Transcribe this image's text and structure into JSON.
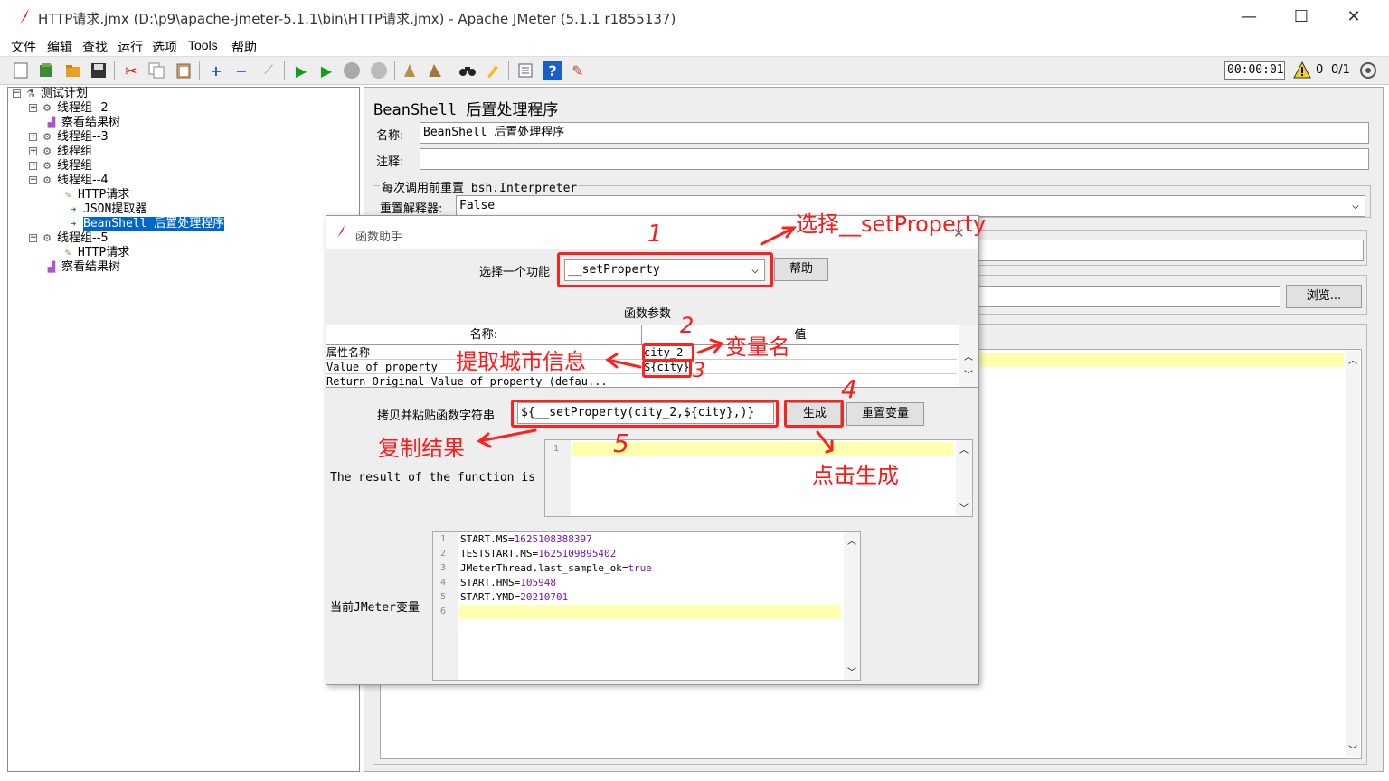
{
  "window": {
    "title": "HTTP请求.jmx (D:\\p9\\apache-jmeter-5.1.1\\bin\\HTTP请求.jmx) - Apache JMeter (5.1.1 r1855137)",
    "minimize": "—",
    "maximize": "☐",
    "close": "✕"
  },
  "menu": [
    "文件",
    "编辑",
    "查找",
    "运行",
    "选项",
    "Tools",
    "帮助"
  ],
  "toolbar": {
    "timer": "00:00:01",
    "warnings": "0",
    "threads": "0/1"
  },
  "tree": [
    {
      "label": "测试计划",
      "icon": "flask-icon"
    },
    {
      "label": "线程组--2",
      "icon": "gear-icon"
    },
    {
      "label": "察看结果树",
      "icon": "chart-icon"
    },
    {
      "label": "线程组--3",
      "icon": "gear-icon"
    },
    {
      "label": "线程组",
      "icon": "gear-icon"
    },
    {
      "label": "线程组",
      "icon": "gear-icon"
    },
    {
      "label": "线程组--4",
      "icon": "gear-icon"
    },
    {
      "label": "HTTP请求",
      "icon": "pen-icon"
    },
    {
      "label": "JSON提取器",
      "icon": "arrow-icon"
    },
    {
      "label": "BeanShell 后置处理程序",
      "icon": "arrow-icon"
    },
    {
      "label": "线程组--5",
      "icon": "gear-icon"
    },
    {
      "label": "HTTP请求",
      "icon": "pen-icon"
    },
    {
      "label": "察看结果树",
      "icon": "chart-icon"
    }
  ],
  "panel": {
    "title": "BeanShell 后置处理程序",
    "name_label": "名称:",
    "name_value": "BeanShell 后置处理程序",
    "comment_label": "注释:",
    "group_title": "每次调用前重置 bsh.Interpreter",
    "reset_label": "重置解释器:",
    "reset_value": "False",
    "browse": "浏览..."
  },
  "dialog": {
    "title": "函数助手",
    "choose_label": "选择一个功能",
    "selected_function": "__setProperty",
    "help": "帮助",
    "params_title": "函数参数",
    "col_name": "名称:",
    "col_value": "值",
    "rows": [
      {
        "name": "属性名称",
        "value": "city_2"
      },
      {
        "name": "Value of property",
        "value": "${city}"
      },
      {
        "name": "Return Original Value of property (defau...",
        "value": ""
      }
    ],
    "copy_label": "拷贝并粘贴函数字符串",
    "function_string": "${__setProperty(city_2,${city},)}",
    "generate": "生成",
    "reset_vars": "重置变量",
    "result_label": "The result of the function is",
    "current_vars_label": "当前JMeter变量",
    "vars": [
      {
        "key": "START.MS",
        "value": "1625108388397"
      },
      {
        "key": "TESTSTART.MS",
        "value": "1625109895402"
      },
      {
        "key": "JMeterThread.last_sample_ok",
        "value": "true"
      },
      {
        "key": "START.HMS",
        "value": "105948"
      },
      {
        "key": "START.YMD",
        "value": "20210701"
      }
    ]
  },
  "annotations": {
    "a1": "选择__setProperty",
    "a2": "变量名",
    "a3": "提取城市信息",
    "a4": "复制结果",
    "a5": "点击生成",
    "n1": "1",
    "n2": "2",
    "n3": "3",
    "n4": "4",
    "n5": "5"
  }
}
